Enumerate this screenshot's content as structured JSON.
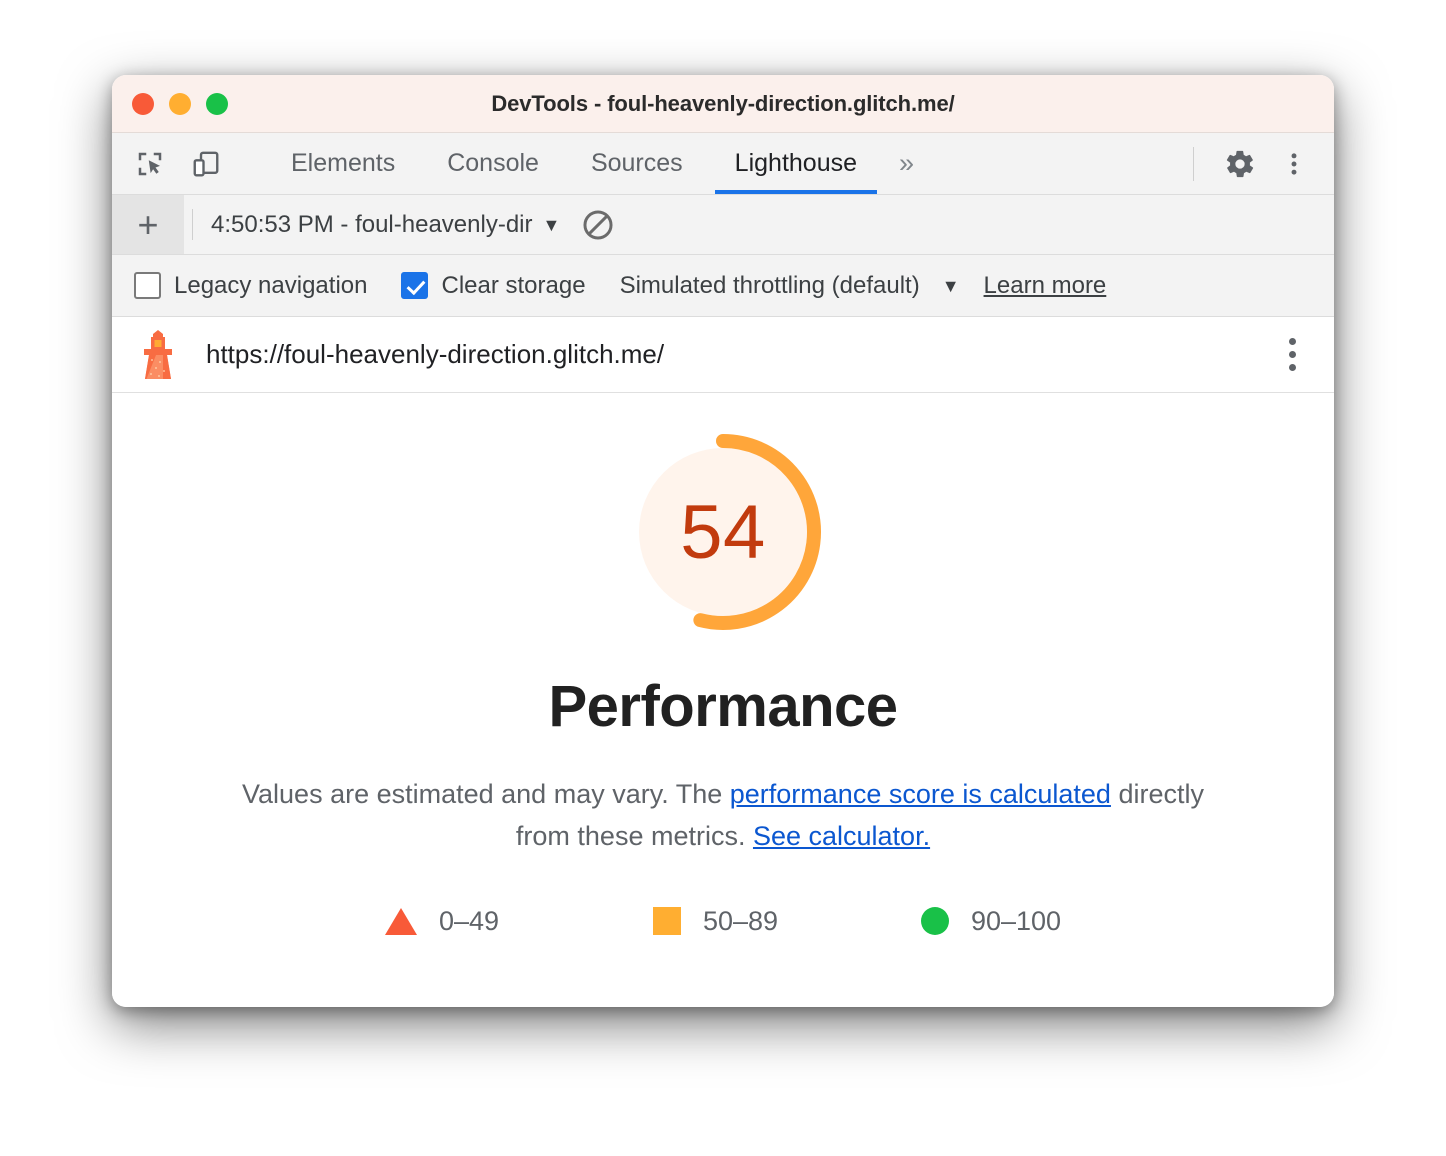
{
  "window": {
    "title": "DevTools - foul-heavenly-direction.glitch.me/",
    "traffic_lights": [
      {
        "name": "close",
        "color": "#f85a38"
      },
      {
        "name": "minimize",
        "color": "#ffae31"
      },
      {
        "name": "maximize",
        "color": "#19c148"
      }
    ]
  },
  "devtools": {
    "left_icons": [
      {
        "name": "inspect-element-icon"
      },
      {
        "name": "device-toolbar-icon"
      }
    ],
    "tabs": [
      {
        "label": "Elements",
        "active": false
      },
      {
        "label": "Console",
        "active": false
      },
      {
        "label": "Sources",
        "active": false
      },
      {
        "label": "Lighthouse",
        "active": true
      }
    ],
    "more_tabs_glyph": "»",
    "settings_icon": "gear-icon",
    "main_menu_icon": "kebab-menu-icon",
    "active_tab_underline_color": "#1a73e8"
  },
  "run_toolbar": {
    "add_label": "+",
    "selected_run": "4:50:53 PM - foul-heavenly-dir",
    "caret": "▼",
    "clear_icon": "no-entry-icon"
  },
  "options": {
    "legacy_navigation": {
      "label": "Legacy navigation",
      "checked": false
    },
    "clear_storage": {
      "label": "Clear storage",
      "checked": true
    },
    "throttling": {
      "label": "Simulated throttling (default)",
      "caret": "▼"
    },
    "learn_more": "Learn more",
    "accent": "#1a73e8"
  },
  "url_row": {
    "icon": "lighthouse-icon",
    "url": "https://foul-heavenly-direction.glitch.me/",
    "menu_icon": "kebab-menu-icon"
  },
  "report": {
    "score": "54",
    "score_value": 54,
    "category_title": "Performance",
    "description_prefix": "Values are estimated and may vary. The ",
    "description_link1": "performance score is calculated",
    "description_middle": " directly from these metrics. ",
    "description_link2": "See calculator.",
    "gauge": {
      "arc_color": "#ffa63a",
      "track_color": "#fff4ec",
      "number_color": "#c23b0e",
      "percent": 54
    },
    "legend": [
      {
        "shape": "triangle",
        "label": "0–49",
        "color": "#f85a38"
      },
      {
        "shape": "square",
        "label": "50–89",
        "color": "#ffae31"
      },
      {
        "shape": "circle",
        "label": "90–100",
        "color": "#19c148"
      }
    ]
  }
}
